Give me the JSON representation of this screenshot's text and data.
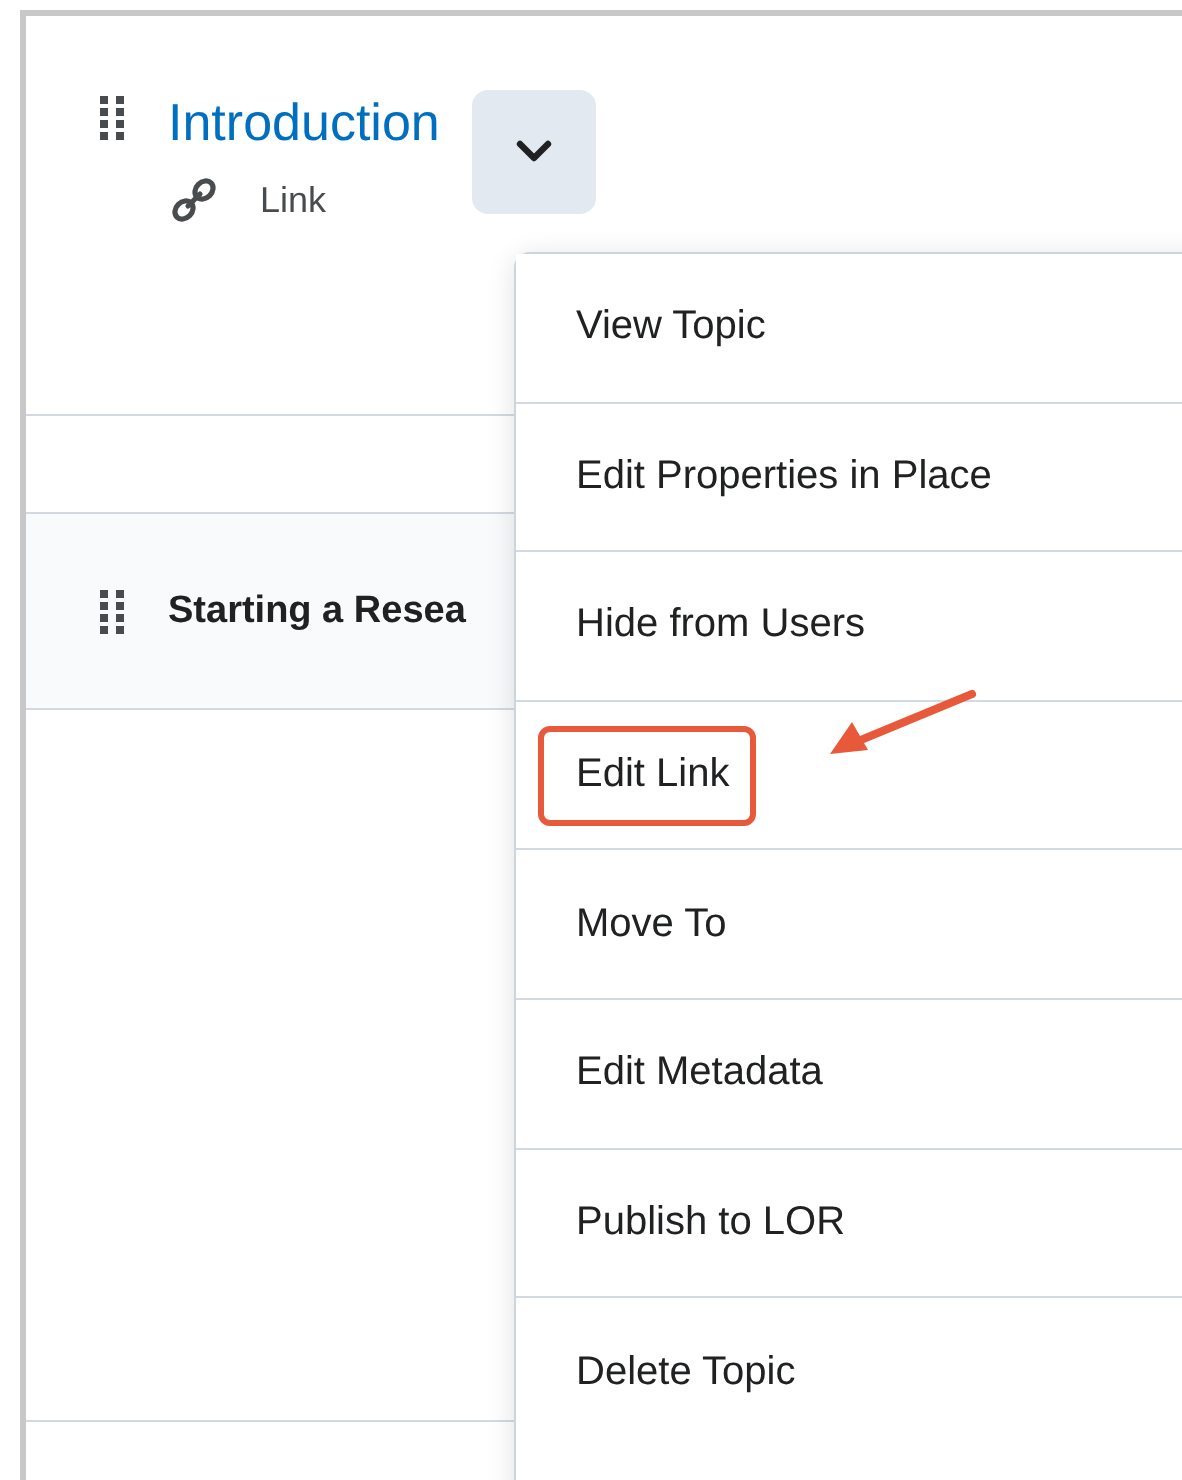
{
  "topic": {
    "title": "Introduction",
    "type": "Link"
  },
  "next_item": {
    "title": "Starting a Resea"
  },
  "menu": {
    "items": [
      {
        "label": "View Topic",
        "highlighted": false
      },
      {
        "label": "Edit Properties in Place",
        "highlighted": false
      },
      {
        "label": "Hide from Users",
        "highlighted": false
      },
      {
        "label": "Edit Link",
        "highlighted": true
      },
      {
        "label": "Move To",
        "highlighted": false
      },
      {
        "label": "Edit Metadata",
        "highlighted": false
      },
      {
        "label": "Publish to LOR",
        "highlighted": false
      },
      {
        "label": "Delete Topic",
        "highlighted": false
      }
    ]
  }
}
